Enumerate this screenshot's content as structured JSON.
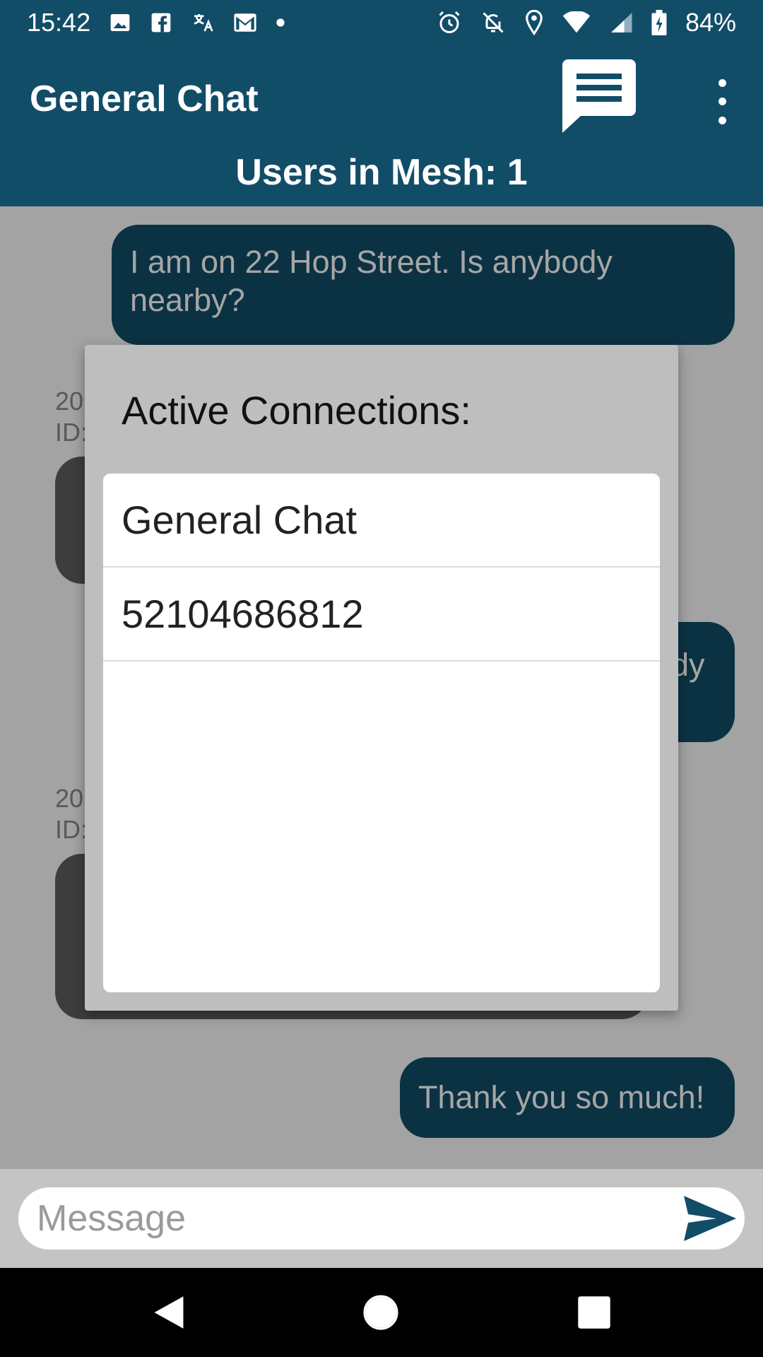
{
  "status_bar": {
    "time": "15:42",
    "battery": "84%",
    "icons": [
      "image-icon",
      "facebook-icon",
      "translate-icon",
      "gmail-icon",
      "dot-icon",
      "alarm-icon",
      "mute-icon",
      "location-icon",
      "wifi-icon",
      "signal-icon",
      "battery-charging-icon"
    ]
  },
  "app_bar": {
    "title": "General Chat",
    "mesh_status": "Users in Mesh: 1",
    "chat_icon": "chat-bubble-icon",
    "menu_icon": "more-vert-icon"
  },
  "messages": [
    {
      "type": "sent",
      "text": "I am on 22 Hop Street. Is anybody nearby?"
    },
    {
      "type": "received",
      "meta_line1": "20",
      "meta_line2": "ID:"
    },
    {
      "type": "sent",
      "text_fragment": "dy"
    },
    {
      "type": "received",
      "meta_line1": "20",
      "meta_line2": "ID:"
    },
    {
      "type": "sent",
      "text": "Thank you so much!"
    }
  ],
  "dialog": {
    "title": "Active Connections:",
    "items": [
      "General Chat",
      "52104686812"
    ]
  },
  "input": {
    "placeholder": "Message",
    "send_icon": "send-icon"
  },
  "nav_bar": {
    "back_icon": "back-icon",
    "home_icon": "home-icon",
    "recents_icon": "recents-icon"
  }
}
